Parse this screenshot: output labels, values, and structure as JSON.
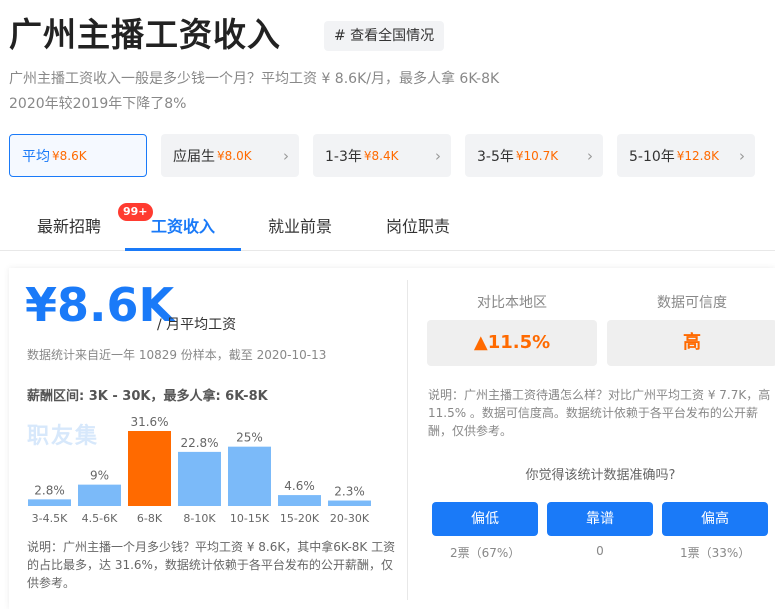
{
  "page": {
    "title": "广州主播工资收入",
    "tag": "# 查看全国情况",
    "desc_line1": "广州主播工资收入一般是多少钱一个月？平均工资 ¥ 8.6K/月，最多人拿 6K-8K",
    "desc_line2": "2020年较2019年下降了8%"
  },
  "experience_tabs": [
    {
      "label": "平均",
      "value": "¥8.6K"
    },
    {
      "label": "应届生",
      "value": "¥8.0K"
    },
    {
      "label": "1-3年",
      "value": "¥8.4K"
    },
    {
      "label": "3-5年",
      "value": "¥10.7K"
    },
    {
      "label": "5-10年",
      "value": "¥12.8K"
    }
  ],
  "nav": {
    "tabs": [
      "最新招聘",
      "工资收入",
      "就业前景",
      "岗位职责"
    ],
    "badge": "99+"
  },
  "salary": {
    "avg": "¥8.6K",
    "unit": "/ 月平均工资",
    "note": "数据统计来自近一年 10829 份样本，截至 2020-10-13",
    "range": "薪酬区间: 3K - 30K，最多人拿:  6K-8K",
    "watermark": "职友集",
    "chart_note": "说明：广州主播一个月多少钱？平均工资 ¥ 8.6K，其中拿6K-8K 工资的占比最多，达 31.6%，数据统计依赖于各平台发布的公开薪酬，仅供参考。"
  },
  "chart_data": {
    "type": "bar",
    "categories": [
      "3-4.5K",
      "4.5-6K",
      "6-8K",
      "8-10K",
      "10-15K",
      "15-20K",
      "20-30K"
    ],
    "values": [
      2.8,
      9,
      31.6,
      22.8,
      25,
      4.6,
      2.3
    ],
    "value_labels": [
      "2.8%",
      "9%",
      "31.6%",
      "22.8%",
      "25%",
      "4.6%",
      "2.3%"
    ],
    "highlight_index": 2,
    "colors": {
      "normal": "#7bbaf9",
      "highlight": "#ff6a00"
    }
  },
  "compare": {
    "region_label": "对比本地区",
    "region_value": "11.5%",
    "trust_label": "数据可信度",
    "trust_value": "高",
    "note": "说明：广州主播工资待遇怎么样？对比广州平均工资 ¥ 7.7K，高 11.5% 。数据可信度高。数据统计依赖于各平台发布的公开薪酬，仅供参考。",
    "question": "你觉得该统计数据准确吗?",
    "votes": [
      {
        "label": "偏低",
        "count": "2票（67%）"
      },
      {
        "label": "靠谱",
        "count": "0"
      },
      {
        "label": "偏高",
        "count": "1票（33%）"
      }
    ]
  },
  "colors": {
    "accent": "#1a7af8",
    "orange": "#ff6a00",
    "badge": "#ff3b30"
  }
}
